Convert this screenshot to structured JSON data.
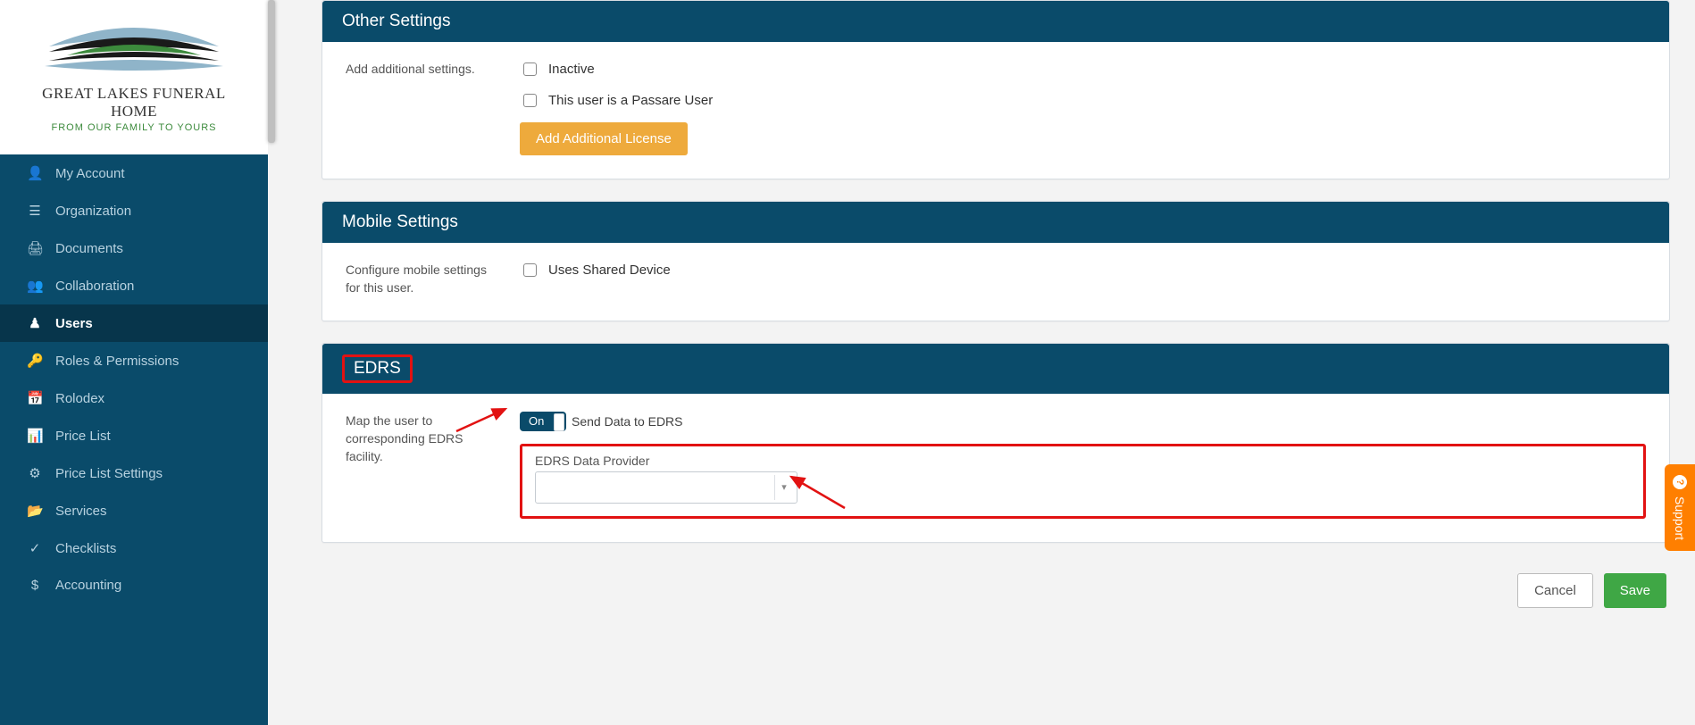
{
  "logo": {
    "title": "GREAT LAKES FUNERAL HOME",
    "subtitle": "FROM OUR FAMILY TO YOURS"
  },
  "sidebar": {
    "items": [
      {
        "label": "My Account",
        "icon": "user-icon"
      },
      {
        "label": "Organization",
        "icon": "list-icon"
      },
      {
        "label": "Documents",
        "icon": "printer-icon"
      },
      {
        "label": "Collaboration",
        "icon": "group-icon"
      },
      {
        "label": "Users",
        "icon": "person-icon",
        "active": true
      },
      {
        "label": "Roles & Permissions",
        "icon": "key-icon"
      },
      {
        "label": "Rolodex",
        "icon": "calendar-icon"
      },
      {
        "label": "Price List",
        "icon": "chart-icon"
      },
      {
        "label": "Price List Settings",
        "icon": "gear-icon"
      },
      {
        "label": "Services",
        "icon": "folder-icon"
      },
      {
        "label": "Checklists",
        "icon": "check-icon"
      },
      {
        "label": "Accounting",
        "icon": "dollar-icon"
      }
    ]
  },
  "panels": {
    "other": {
      "title": "Other Settings",
      "desc": "Add additional settings.",
      "inactive_label": "Inactive",
      "passare_label": "This user is a Passare User",
      "add_license_label": "Add Additional License"
    },
    "mobile": {
      "title": "Mobile Settings",
      "desc": "Configure mobile settings for this user.",
      "shared_device_label": "Uses Shared Device"
    },
    "edrs": {
      "title": "EDRS",
      "desc": "Map the user to corresponding EDRS facility.",
      "toggle_label": "On",
      "toggle_text": "Send Data to EDRS",
      "provider_label": "EDRS Data Provider",
      "provider_value": ""
    }
  },
  "footer": {
    "cancel": "Cancel",
    "save": "Save"
  },
  "support": {
    "label": "Support"
  }
}
